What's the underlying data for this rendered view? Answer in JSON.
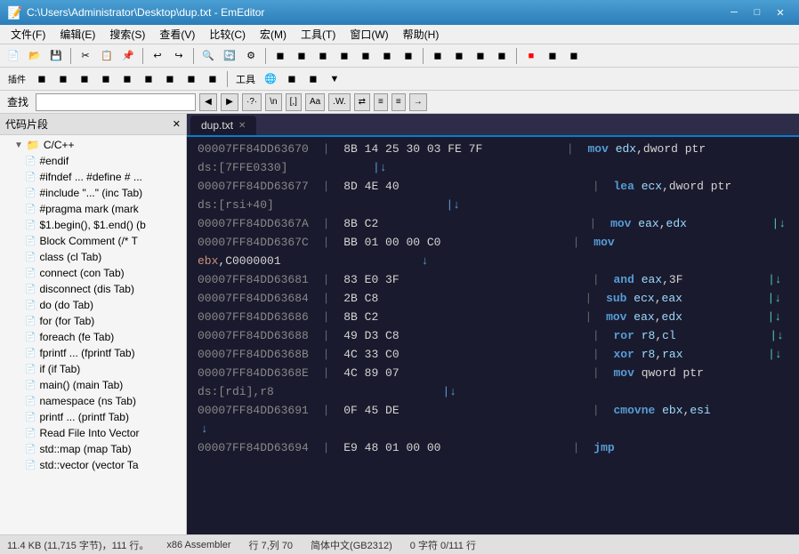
{
  "titleBar": {
    "title": "C:\\Users\\Administrator\\Desktop\\dup.txt - EmEditor",
    "minBtn": "─",
    "maxBtn": "□",
    "closeBtn": "✕"
  },
  "menuBar": {
    "items": [
      "文件(F)",
      "编辑(E)",
      "搜索(S)",
      "查看(V)",
      "比较(C)",
      "宏(M)",
      "工具(T)",
      "窗口(W)",
      "帮助(H)"
    ]
  },
  "searchBar": {
    "label": "查找",
    "placeholder": ""
  },
  "sidebar": {
    "title": "代码片段",
    "items": [
      {
        "label": "C/C++",
        "type": "folder",
        "indent": 1
      },
      {
        "label": "#endif",
        "type": "file",
        "indent": 2
      },
      {
        "label": "#ifndef ... #define # ...",
        "type": "file",
        "indent": 2
      },
      {
        "label": "#include \"...\" (inc Tab)",
        "type": "file",
        "indent": 2
      },
      {
        "label": "#pragma mark (mark",
        "type": "file",
        "indent": 2
      },
      {
        "label": "$1.begin(), $1.end() (b",
        "type": "file",
        "indent": 2
      },
      {
        "label": "Block Comment (/* T",
        "type": "file",
        "indent": 2
      },
      {
        "label": "class (cl Tab)",
        "type": "file",
        "indent": 2
      },
      {
        "label": "connect (con Tab)",
        "type": "file",
        "indent": 2
      },
      {
        "label": "disconnect (dis Tab)",
        "type": "file",
        "indent": 2
      },
      {
        "label": "do (do Tab)",
        "type": "file",
        "indent": 2
      },
      {
        "label": "for (for Tab)",
        "type": "file",
        "indent": 2
      },
      {
        "label": "foreach (fe Tab)",
        "type": "file",
        "indent": 2
      },
      {
        "label": "fprintf ... (fprintf Tab)",
        "type": "file",
        "indent": 2
      },
      {
        "label": "if (if Tab)",
        "type": "file",
        "indent": 2
      },
      {
        "label": "main() (main Tab)",
        "type": "file",
        "indent": 2
      },
      {
        "label": "namespace (ns Tab)",
        "type": "file",
        "indent": 2
      },
      {
        "label": "printf ... (printf Tab)",
        "type": "file",
        "indent": 2
      },
      {
        "label": "Read File Into Vector",
        "type": "file",
        "indent": 2
      },
      {
        "label": "std::map (map Tab)",
        "type": "file",
        "indent": 2
      },
      {
        "label": "std::vector (vector Ta",
        "type": "file",
        "indent": 2
      }
    ]
  },
  "editor": {
    "tab": "dup.txt",
    "lines": [
      {
        "addr": "00007FF84DD63670",
        "hex": "8B 14 25 30 03 FE 7F",
        "spaces": "       ",
        "pipe": "|",
        "asm": " mov edx,dword ptr"
      },
      {
        "addr": "ds:[7FFE0330]",
        "hex": "",
        "spaces": "         ",
        "pipe": "|↓",
        "asm": ""
      },
      {
        "addr": "00007FF84DD63677",
        "hex": "8D 4E 40",
        "spaces": "              ",
        "pipe": "|",
        "asm": " lea ecx,dword ptr"
      },
      {
        "addr": "ds:[rsi+40]",
        "hex": "",
        "spaces": "            ",
        "pipe": "|↓",
        "asm": ""
      },
      {
        "addr": "00007FF84DD6367A",
        "hex": "8B C2",
        "spaces": "              ",
        "pipe": "|",
        "asm": " mov eax,edx",
        "arrow": "↓"
      },
      {
        "addr": "00007FF84DD6367C",
        "hex": "BB 01 00 00 C0",
        "spaces": "         ",
        "pipe": "|",
        "asm": " mov"
      },
      {
        "addr": "ebx,C0000001",
        "hex": "",
        "spaces": "          ",
        "pipe": "↓",
        "asm": ""
      },
      {
        "addr": "00007FF84DD63681",
        "hex": "83 E0 3F",
        "spaces": "              ",
        "pipe": "|",
        "asm": " and eax,3F",
        "arrow": "↓"
      },
      {
        "addr": "00007FF84DD63684",
        "hex": "2B C8",
        "spaces": "              ",
        "pipe": "|",
        "asm": " sub ecx,eax",
        "arrow": "↓"
      },
      {
        "addr": "00007FF84DD63686",
        "hex": "8B C2",
        "spaces": "              ",
        "pipe": "|",
        "asm": " mov eax,edx",
        "arrow": "↓"
      },
      {
        "addr": "00007FF84DD63688",
        "hex": "49 D3 C8",
        "spaces": "              ",
        "pipe": "|",
        "asm": " ror r8,cl",
        "arrow": "↓"
      },
      {
        "addr": "00007FF84DD6368B",
        "hex": "4C 33 C0",
        "spaces": "              ",
        "pipe": "|",
        "asm": " xor r8,rax",
        "arrow": "↓"
      },
      {
        "addr": "00007FF84DD6368E",
        "hex": "4C 89 07",
        "spaces": "              ",
        "pipe": "|",
        "asm": " mov qword ptr"
      },
      {
        "addr": "ds:[rdi],r8",
        "hex": "",
        "spaces": "            ",
        "pipe": "|↓",
        "asm": ""
      },
      {
        "addr": "00007FF84DD63691",
        "hex": "0F 45 DE",
        "spaces": "              ",
        "pipe": "|",
        "asm": " cmovne ebx,esi"
      },
      {
        "addr": "↓",
        "hex": "",
        "spaces": "",
        "pipe": "",
        "asm": ""
      },
      {
        "addr": "00007FF84DD63694",
        "hex": "E9 48 01 00 00",
        "spaces": "         ",
        "pipe": "|",
        "asm": " jmp"
      }
    ]
  },
  "statusBar": {
    "fileSize": "11.4 KB (11,715 字节)，111 行。",
    "mode": "x86 Assembler",
    "position": "行 7,列 70",
    "encoding": "简体中文(GB2312)",
    "selection": "0 字符 0/111 行"
  }
}
